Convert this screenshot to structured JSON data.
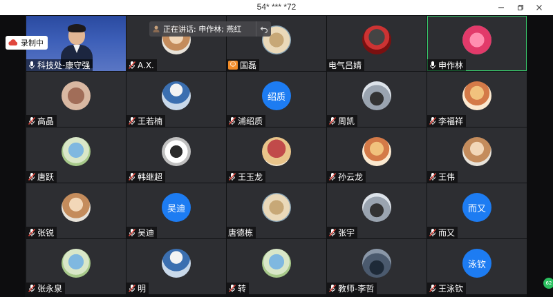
{
  "window": {
    "title": "54* *** *72"
  },
  "speaking_bar": {
    "text": "正在讲话: 申作林; 燕红"
  },
  "recording": {
    "label": "录制中"
  },
  "participants": [
    {
      "name": "科技处-康守强",
      "kind": "video",
      "mic": "on"
    },
    {
      "name": "A.X.",
      "kind": "photo",
      "avatar": "photo-a",
      "mic": "muted"
    },
    {
      "name": "国磊",
      "kind": "photo",
      "avatar": "photo-l",
      "mic": "host"
    },
    {
      "name": "电气吕婧",
      "kind": "photo",
      "avatar": "photo-f",
      "mic": "none"
    },
    {
      "name": "申作林",
      "kind": "photo",
      "avatar": "photo-g",
      "mic": "on",
      "active": true
    },
    {
      "name": "高晶",
      "kind": "photo",
      "avatar": "photo-h",
      "mic": "muted"
    },
    {
      "name": "王若楠",
      "kind": "photo",
      "avatar": "photo-b",
      "mic": "muted"
    },
    {
      "name": "浦绍质",
      "kind": "initials",
      "initials": "绍质",
      "mic": "muted"
    },
    {
      "name": "周凯",
      "kind": "photo",
      "avatar": "photo-i",
      "mic": "muted"
    },
    {
      "name": "李福祥",
      "kind": "photo",
      "avatar": "photo-e",
      "mic": "muted"
    },
    {
      "name": "唐跃",
      "kind": "photo",
      "avatar": "photo-d",
      "mic": "muted"
    },
    {
      "name": "韩继超",
      "kind": "photo",
      "avatar": "photo-j",
      "mic": "muted"
    },
    {
      "name": "王玉龙",
      "kind": "photo",
      "avatar": "photo-c",
      "mic": "muted"
    },
    {
      "name": "孙云龙",
      "kind": "photo",
      "avatar": "photo-e",
      "mic": "muted"
    },
    {
      "name": "王伟",
      "kind": "photo",
      "avatar": "photo-a",
      "mic": "muted"
    },
    {
      "name": "张锐",
      "kind": "photo",
      "avatar": "photo-a",
      "mic": "muted"
    },
    {
      "name": "吴迪",
      "kind": "initials",
      "initials": "吴迪",
      "mic": "muted"
    },
    {
      "name": "唐德栋",
      "kind": "photo",
      "avatar": "photo-l",
      "mic": "none"
    },
    {
      "name": "张宇",
      "kind": "photo",
      "avatar": "photo-i",
      "mic": "muted"
    },
    {
      "name": "而又",
      "kind": "initials",
      "initials": "而又",
      "mic": "muted"
    },
    {
      "name": "张永泉",
      "kind": "photo",
      "avatar": "photo-d",
      "mic": "muted"
    },
    {
      "name": "明",
      "kind": "photo",
      "avatar": "photo-b",
      "mic": "muted"
    },
    {
      "name": "转",
      "kind": "photo",
      "avatar": "photo-d",
      "mic": "muted"
    },
    {
      "name": "教师-李哲",
      "kind": "photo",
      "avatar": "photo-k",
      "mic": "muted"
    },
    {
      "name": "王泳钦",
      "kind": "initials",
      "initials": "泳钦",
      "mic": "muted"
    }
  ],
  "colors": {
    "tile_bg": "#2d2e32",
    "initials_bg": "#1d7cf2",
    "active_border": "#38c96b",
    "muted_icon": "#e0463c",
    "host_icon": "#f28c28"
  }
}
